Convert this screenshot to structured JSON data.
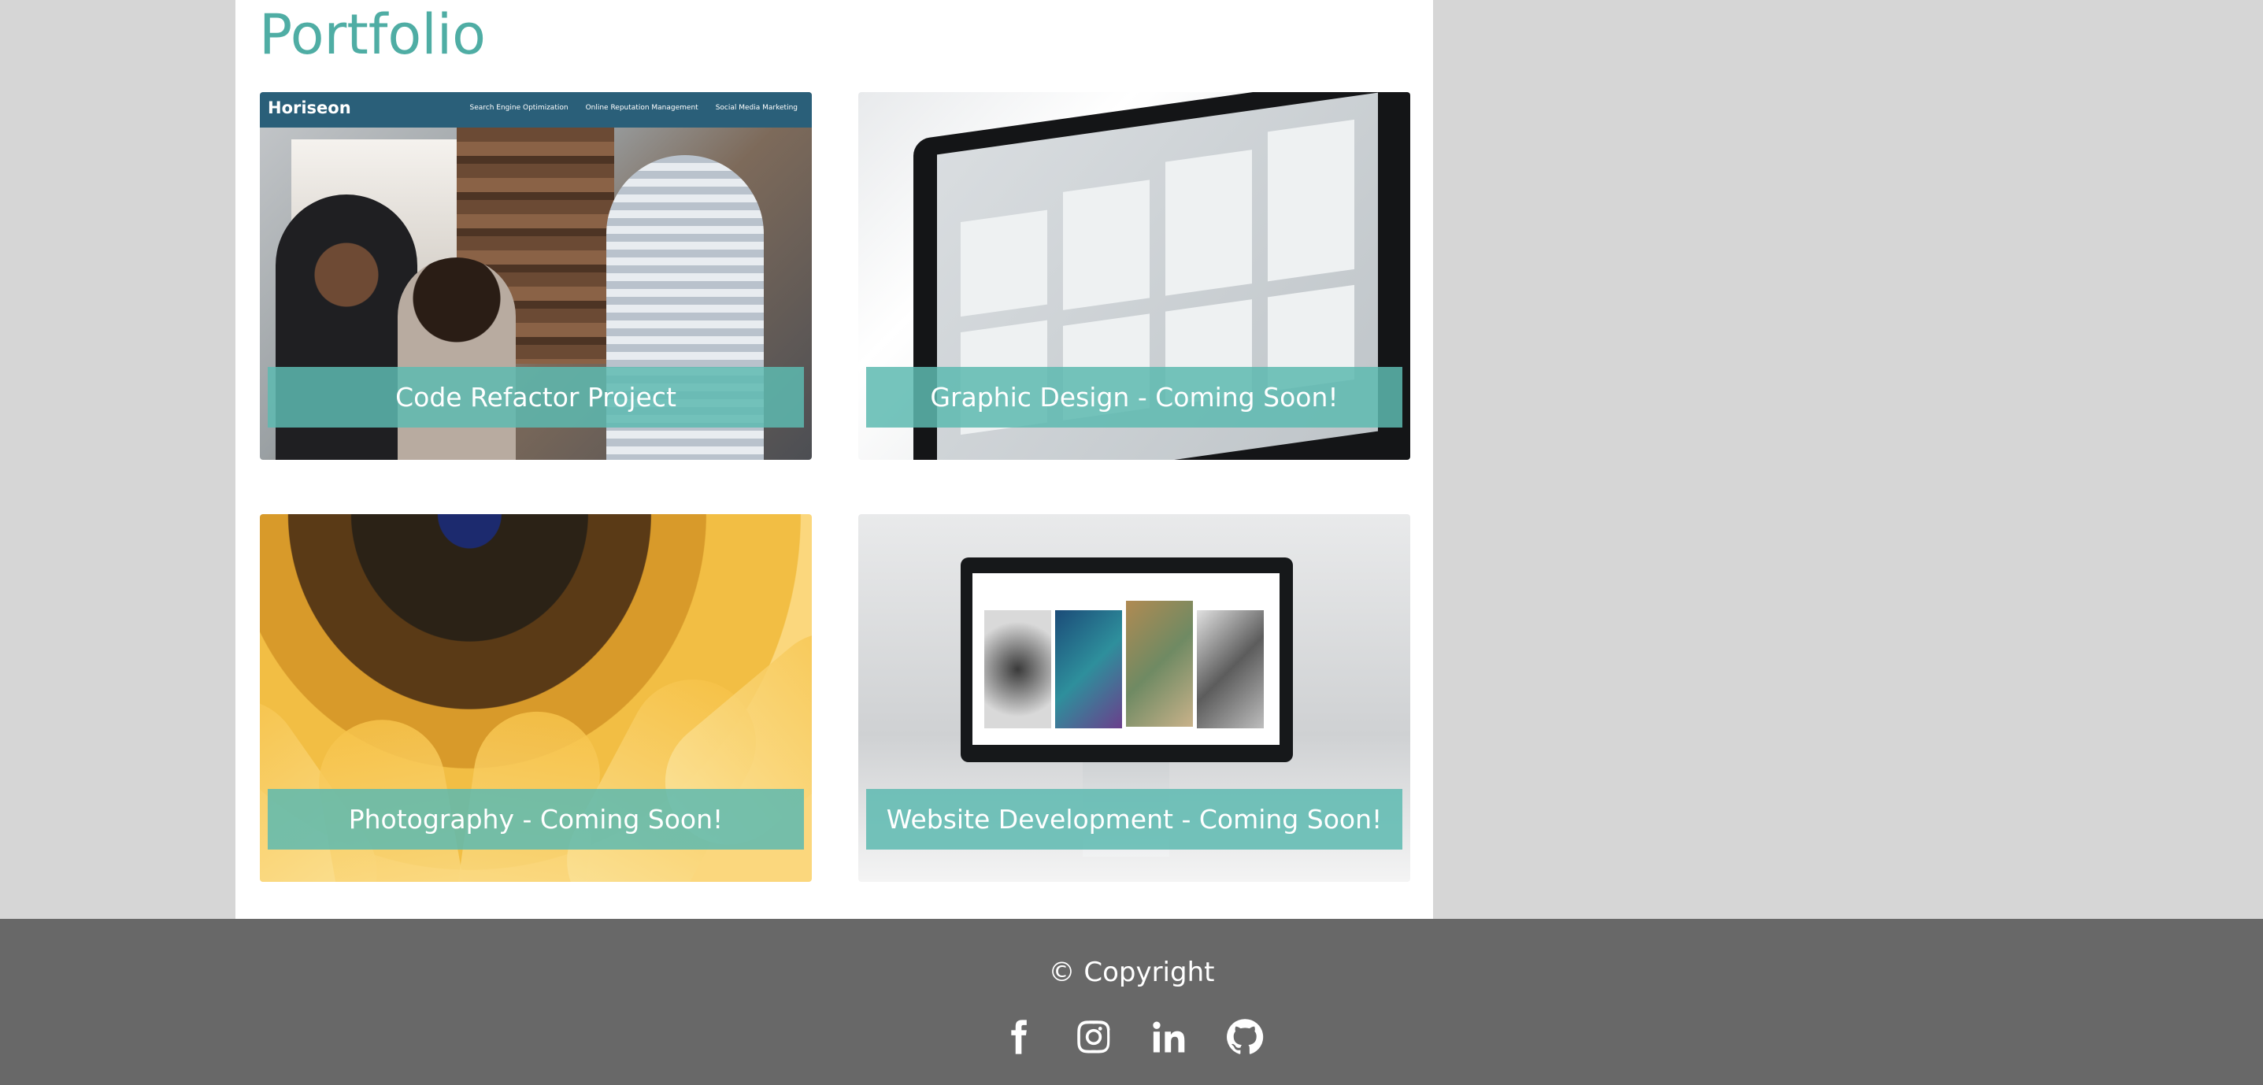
{
  "portfolio": {
    "title": "Portfolio",
    "cards": [
      {
        "caption": "Code Refactor Project",
        "preview": {
          "brand": "Horiseon",
          "nav": [
            "Search Engine Optimization",
            "Online Reputation Management",
            "Social Media Marketing"
          ]
        }
      },
      {
        "caption": "Graphic Design - Coming Soon!"
      },
      {
        "caption": "Photography - Coming Soon!"
      },
      {
        "caption": "Website Development - Coming Soon!"
      }
    ]
  },
  "footer": {
    "copyright": "© Copyright",
    "social_icons": [
      "facebook-icon",
      "instagram-icon",
      "linkedin-icon",
      "github-icon"
    ]
  },
  "colors": {
    "accent": "#4fada4",
    "caption_bg": "#5dbab0",
    "footer_bg": "#686868",
    "page_bg": "#d6d6d6"
  }
}
